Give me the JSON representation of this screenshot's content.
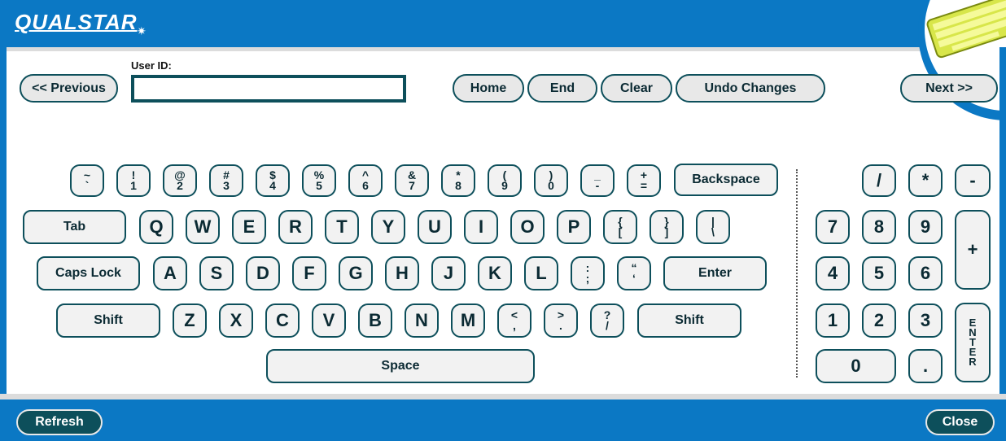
{
  "app": {
    "logo_text": "QUALSTAR",
    "logo_mark": "✷"
  },
  "user_id": {
    "label": "User ID:",
    "value": ""
  },
  "nav": {
    "previous": "<< Previous",
    "home": "Home",
    "end": "End",
    "clear": "Clear",
    "undo": "Undo Changes",
    "next": "Next >>"
  },
  "keyboard": {
    "row1": [
      {
        "top": "~",
        "bottom": "`"
      },
      {
        "top": "!",
        "bottom": "1"
      },
      {
        "top": "@",
        "bottom": "2"
      },
      {
        "top": "#",
        "bottom": "3"
      },
      {
        "top": "$",
        "bottom": "4"
      },
      {
        "top": "%",
        "bottom": "5"
      },
      {
        "top": "^",
        "bottom": "6"
      },
      {
        "top": "&",
        "bottom": "7"
      },
      {
        "top": "*",
        "bottom": "8"
      },
      {
        "top": "(",
        "bottom": "9"
      },
      {
        "top": ")",
        "bottom": "0"
      },
      {
        "top": "_",
        "bottom": "-"
      },
      {
        "top": "+",
        "bottom": "="
      }
    ],
    "backspace": "Backspace",
    "tab": "Tab",
    "row2": [
      "Q",
      "W",
      "E",
      "R",
      "T",
      "Y",
      "U",
      "I",
      "O",
      "P"
    ],
    "row2_sym": [
      {
        "top": "{",
        "bottom": "["
      },
      {
        "top": "}",
        "bottom": "]"
      },
      {
        "top": "|",
        "bottom": "\\"
      }
    ],
    "caps": "Caps Lock",
    "row3": [
      "A",
      "S",
      "D",
      "F",
      "G",
      "H",
      "J",
      "K",
      "L"
    ],
    "row3_sym": [
      {
        "top": ":",
        "bottom": ";"
      },
      {
        "top": "“",
        "bottom": "‘"
      }
    ],
    "enter": "Enter",
    "shift_left": "Shift",
    "row4": [
      "Z",
      "X",
      "C",
      "V",
      "B",
      "N",
      "M"
    ],
    "row4_sym": [
      {
        "top": "<",
        "bottom": ","
      },
      {
        "top": ">",
        "bottom": "."
      },
      {
        "top": "?",
        "bottom": "/"
      }
    ],
    "shift_right": "Shift",
    "space": "Space"
  },
  "numpad": {
    "ops": [
      "/",
      "*",
      "-"
    ],
    "row_789": [
      "7",
      "8",
      "9"
    ],
    "plus": "+",
    "row_456": [
      "4",
      "5",
      "6"
    ],
    "row_123": [
      "1",
      "2",
      "3"
    ],
    "enter_letters": [
      "E",
      "N",
      "T",
      "E",
      "R"
    ],
    "zero": "0",
    "dot": "."
  },
  "footer": {
    "refresh": "Refresh",
    "close": "Close"
  },
  "colors": {
    "brand_blue": "#0b78c4",
    "key_border": "#0d4f5b",
    "key_fill": "#f2f2f2",
    "band_gray": "#dcdcdc"
  },
  "icons": {
    "corner": "keyboard-icon"
  }
}
